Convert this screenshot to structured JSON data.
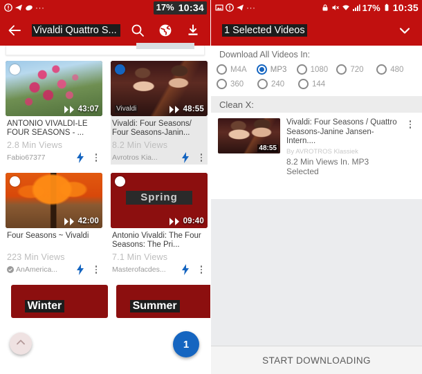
{
  "left": {
    "status_bar": {
      "icons": [
        "notification-icon",
        "telegram-icon",
        "app-icon",
        "more-icon"
      ],
      "battery_percent": "17%",
      "time": "10:34"
    },
    "appbar": {
      "back_icon": "back-arrow-icon",
      "search_query": "Vivaldi Quattro S...",
      "search_icon": "search-icon",
      "globe_icon": "globe-icon",
      "download_icon": "download-icon"
    },
    "videos": [
      {
        "title": "ANTONIO VIVALDI-LE FOUR SEASONS - ...",
        "views": "2.8 Min Views",
        "channel": "Fabio67377",
        "duration": "43:07",
        "selected": false,
        "verified": false,
        "art": "art-blossom"
      },
      {
        "title": "Vivaldi: Four Seasons/ Four Seasons-Janin...",
        "views": "8.2 Min Views",
        "channel": "Avrotros Kia...",
        "duration": "48:55",
        "selected": true,
        "verified": false,
        "art": "art-violin",
        "overlay_word": "Vivaldi"
      },
      {
        "title": "Four Seasons ~ Vivaldi",
        "views": "223 Min Views",
        "channel": "AnAmerica...",
        "duration": "42:00",
        "selected": false,
        "verified": true,
        "art": "art-autumn"
      },
      {
        "title": "Antonio Vivaldi: The Four Seasons: The Pri...",
        "views": "7.1 Min Views",
        "channel": "Masterofacdes...",
        "duration": "09:40",
        "selected": false,
        "verified": false,
        "art": "art-spring",
        "overlay_word": "Spring"
      }
    ],
    "bottom_videos": [
      {
        "overlay_word": "Winter",
        "selected": false
      },
      {
        "overlay_word": "Summer",
        "selected": false
      }
    ],
    "scroll_up_icon": "chevron-up-icon",
    "selected_count_badge": "1"
  },
  "right": {
    "status_bar": {
      "icons": [
        "image-icon",
        "notification-icon",
        "telegram-icon",
        "more-icon",
        "lock-icon",
        "mute-icon",
        "wifi-icon",
        "signal-icon"
      ],
      "battery_percent": "17%",
      "time": "10:35"
    },
    "appbar": {
      "title": "1 Selected Videos",
      "chevron_icon": "chevron-down-icon"
    },
    "download_label": "Download All Videos In:",
    "formats_row1": [
      {
        "label": "M4A",
        "selected": false
      },
      {
        "label": "MP3",
        "selected": true
      },
      {
        "label": "1080",
        "selected": false
      },
      {
        "label": "720",
        "selected": false
      },
      {
        "label": "480",
        "selected": false
      }
    ],
    "formats_row2": [
      {
        "label": "360",
        "selected": false
      },
      {
        "label": "240",
        "selected": false
      },
      {
        "label": "144",
        "selected": false
      }
    ],
    "clean_label": "Clean X:",
    "download_item": {
      "title": "Vivaldi: Four Seasons / Quattro Seasons-Janine Jansen-Intern....",
      "by": "By AVROTROS Klassiek",
      "status": "8.2 Min Views In.  MP3 Selected",
      "duration": "48:55",
      "kebab_icon": "kebab-menu-icon"
    },
    "start_button": "START DOWNLOADING"
  },
  "colors": {
    "brand_red": "#c1100f",
    "accent_blue": "#1565c0",
    "panel_gray": "#ebecee",
    "bar_gray": "#ececec"
  }
}
